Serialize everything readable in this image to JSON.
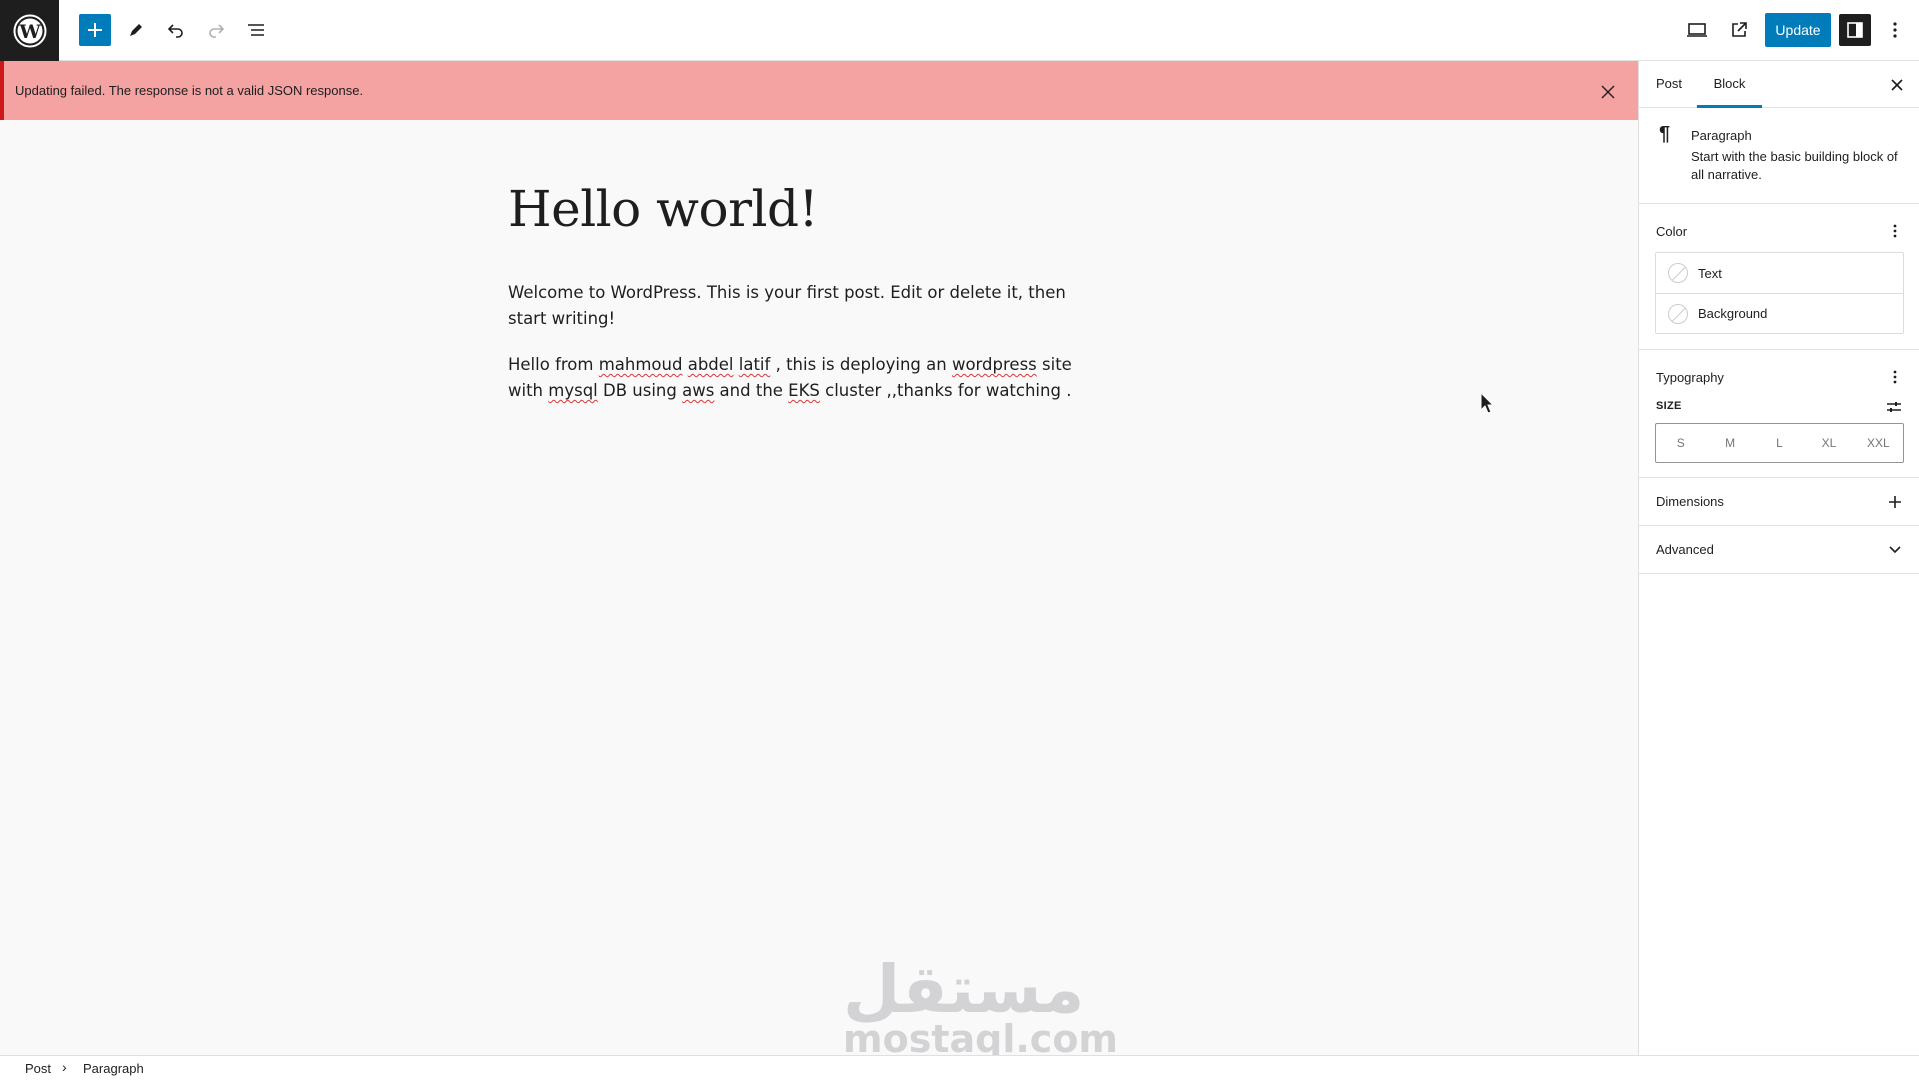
{
  "toolbar": {
    "update_label": "Update"
  },
  "notice": {
    "message": "Updating failed. The response is not a valid JSON response."
  },
  "post": {
    "title": "Hello world!",
    "paragraph_1": "Welcome to WordPress. This is your first post. Edit or delete it, then start writing!",
    "paragraph_2_parts": [
      "Hello from ",
      "mahmoud",
      " ",
      "abdel",
      " ",
      "latif",
      " , this is deploying an ",
      "wordpress",
      " site with ",
      "mysql",
      " DB using ",
      "aws",
      " and the ",
      "EKS",
      " cluster ,,thanks for watching ."
    ]
  },
  "watermark": {
    "arabic": "مستقل",
    "latin": "mostaql.com"
  },
  "breadcrumb": {
    "items": [
      "Post",
      "Paragraph"
    ]
  },
  "sidebar": {
    "tabs": [
      {
        "label": "Post",
        "active": false
      },
      {
        "label": "Block",
        "active": true
      }
    ],
    "block": {
      "icon": "¶",
      "name": "Paragraph",
      "description": "Start with the basic building block of all narrative."
    },
    "color": {
      "title": "Color",
      "items": [
        "Text",
        "Background"
      ]
    },
    "typography": {
      "title": "Typography",
      "size_label": "SIZE",
      "sizes": [
        "S",
        "M",
        "L",
        "XL",
        "XXL"
      ]
    },
    "dimensions": {
      "title": "Dimensions"
    },
    "advanced": {
      "title": "Advanced"
    }
  },
  "colors": {
    "accent": "#007cba",
    "notice_bg": "#f4a2a2",
    "notice_border": "#cc1818",
    "dark": "#1e1e1e"
  }
}
